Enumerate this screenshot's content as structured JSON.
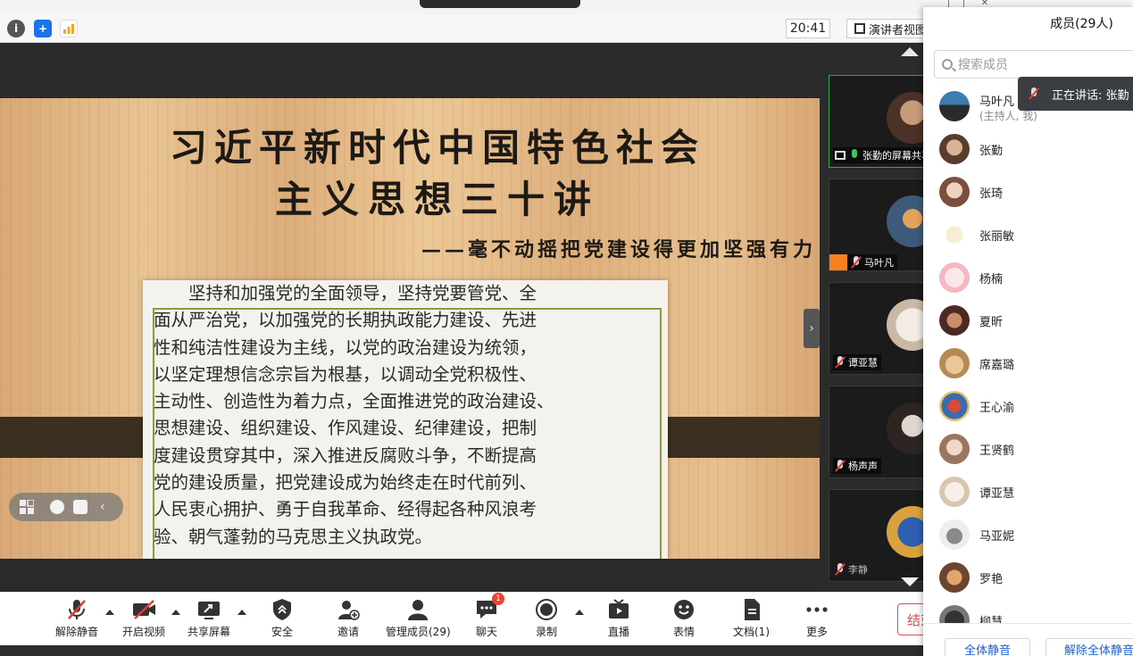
{
  "status": {
    "time": "20:41",
    "view_label": "演讲者视图"
  },
  "slide": {
    "title_line1": "习近平新时代中国特色社会",
    "title_line2": "主义思想三十讲",
    "subtitle": "——毫不动摇把党建设得更加坚强有力",
    "body_lines": [
      "　　坚持和加强党的全面领导，坚持党要管党、全",
      "面从严治党，以加强党的长期执政能力建设、先进",
      "性和纯洁性建设为主线，以党的政治建设为统领，",
      "以坚定理想信念宗旨为根基，以调动全党积极性、",
      "主动性、创造性为着力点，全面推进党的政治建设、",
      "思想建设、组织建设、作风建设、纪律建设，把制",
      "度建设贯穿其中，深入推进反腐败斗争，不断提高",
      "党的建设质量，把党建设成为始终走在时代前列、",
      "人民衷心拥护、勇于自我革命、经得起各种风浪考",
      "验、朝气蓬勃的马克思主义执政党。"
    ]
  },
  "videos": [
    {
      "name": "张勤的屏幕共享"
    },
    {
      "name": "马叶凡"
    },
    {
      "name": "谭亚慧"
    },
    {
      "name": "杨声声"
    },
    {
      "name": "李静"
    }
  ],
  "toolbar": {
    "unmute": "解除静音",
    "video": "开启视频",
    "share": "共享屏幕",
    "security": "安全",
    "invite": "邀请",
    "manage": "管理成员(29)",
    "chat": "聊天",
    "chat_badge": "1",
    "record": "录制",
    "live": "直播",
    "reactions": "表情",
    "docs": "文档(1)",
    "more": "更多",
    "end": "结束会议"
  },
  "panel": {
    "title": "成员(29人)",
    "search_placeholder": "搜索成员",
    "speaking": "正在讲话: 张勤",
    "host_role": "(主持人, 我)",
    "members": [
      {
        "name": "马叶凡"
      },
      {
        "name": "张勤"
      },
      {
        "name": "张琦"
      },
      {
        "name": "张丽敏"
      },
      {
        "name": "杨楠"
      },
      {
        "name": "夏昕"
      },
      {
        "name": "席嘉璐"
      },
      {
        "name": "王心渝"
      },
      {
        "name": "王贤鹤"
      },
      {
        "name": "谭亚慧"
      },
      {
        "name": "马亚妮"
      },
      {
        "name": "罗艳"
      },
      {
        "name": "柳慧"
      }
    ],
    "mute_all": "全体静音",
    "unmute_all": "解除全体静音"
  },
  "colors": {
    "accent_blue": "#1a5fd8",
    "end_red": "#e64a4a",
    "speaking_green": "#2fa84f",
    "badge_red": "#f2412f"
  }
}
